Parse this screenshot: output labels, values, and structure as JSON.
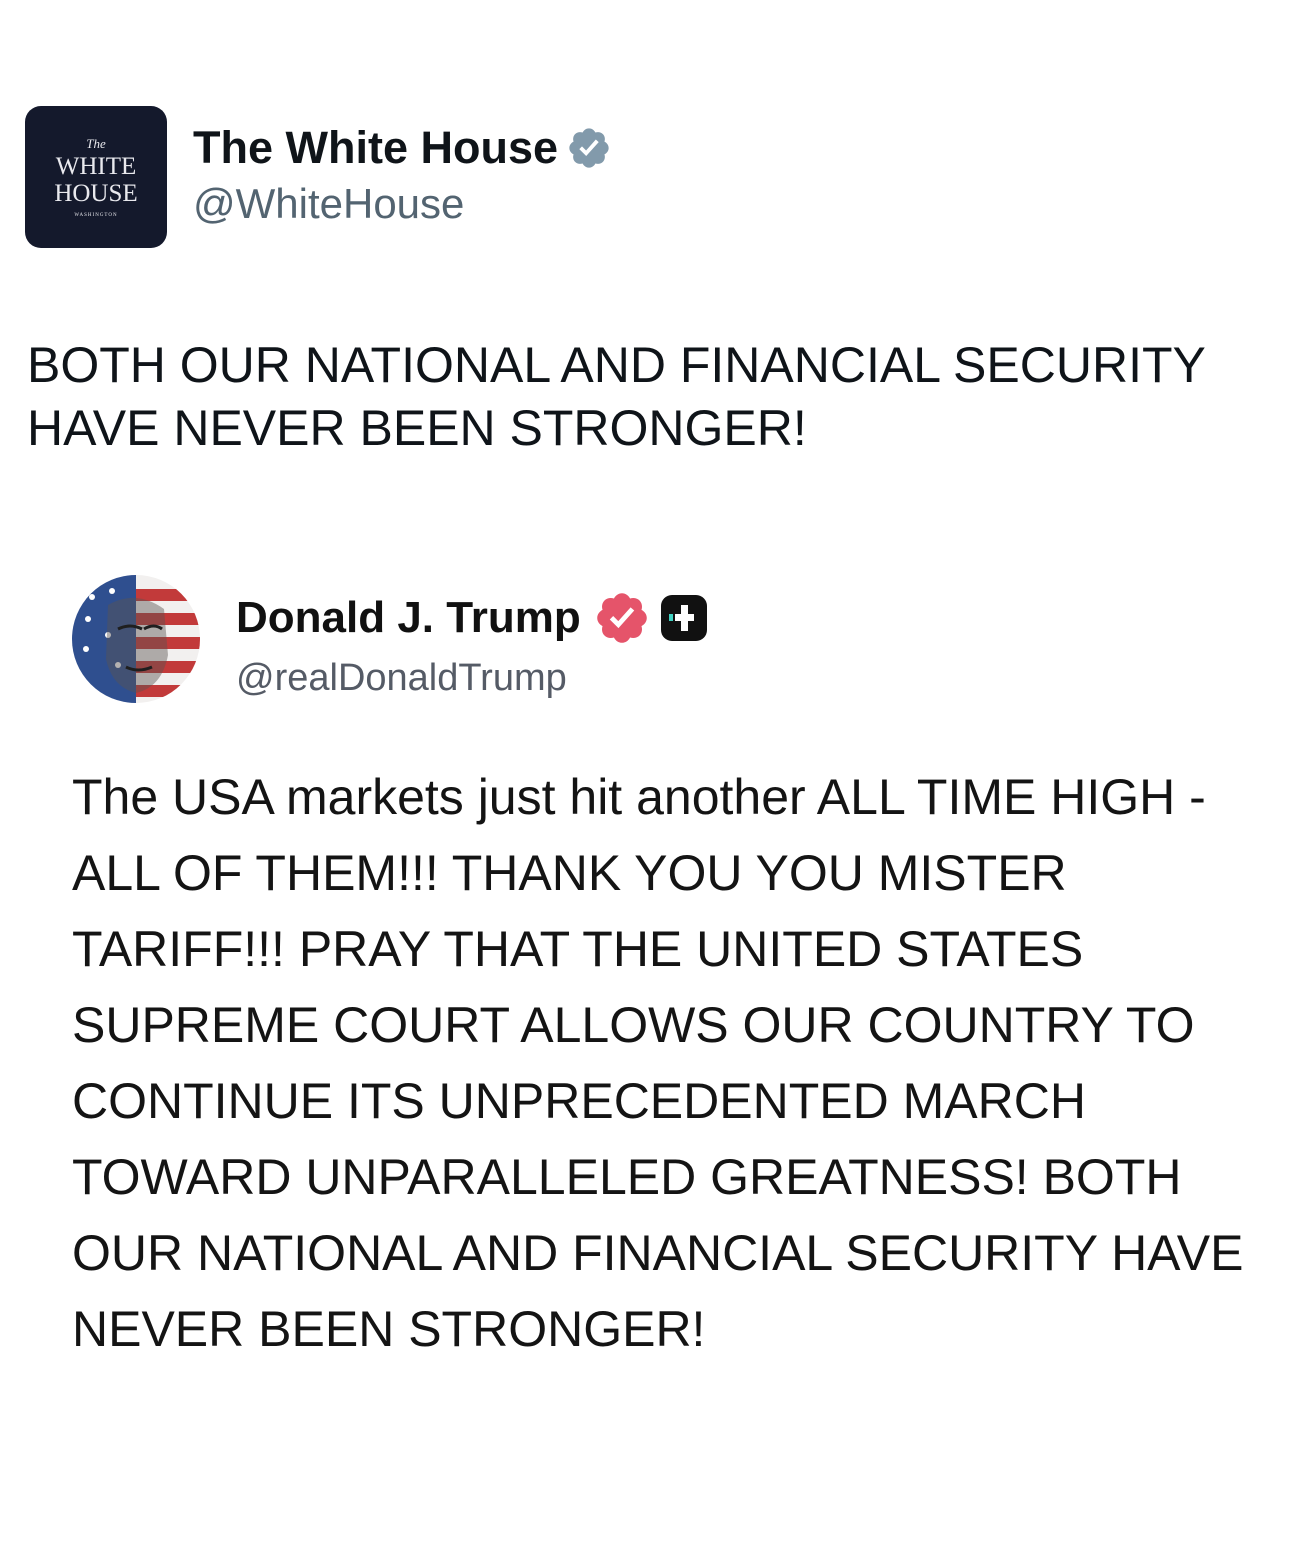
{
  "post": {
    "author": {
      "avatar": {
        "top": "The",
        "line1": "WHITE",
        "line2": "HOUSE",
        "bottom": "WASHINGTON"
      },
      "display_name": "The White House",
      "handle": "@WhiteHouse",
      "verified": true,
      "verified_icon": "verified-badge-icon",
      "verified_color": "#829aab"
    },
    "text": "BOTH OUR NATIONAL AND FINANCIAL SECURITY HAVE NEVER BEEN STRONGER!"
  },
  "quoted_post": {
    "author": {
      "avatar_icon": "flag-portrait-avatar",
      "display_name": "Donald J. Trump",
      "handle": "@realDonaldTrump",
      "verified": true,
      "verified_icon": "verified-badge-icon",
      "verified_color": "#e5546a",
      "subscriber_icon": "truth-plus-icon"
    },
    "text": "The USA markets just hit another ALL TIME HIGH - ALL OF THEM!!! THANK YOU YOU MISTER TARIFF!!! PRAY THAT THE UNITED STATES SUPREME COURT ALLOWS OUR COUNTRY TO CONTINUE ITS UNPRECEDENTED MARCH TOWARD UNPARALLELED GREATNESS! BOTH OUR NATIONAL AND FINANCIAL SECURITY HAVE NEVER BEEN STRONGER!"
  }
}
